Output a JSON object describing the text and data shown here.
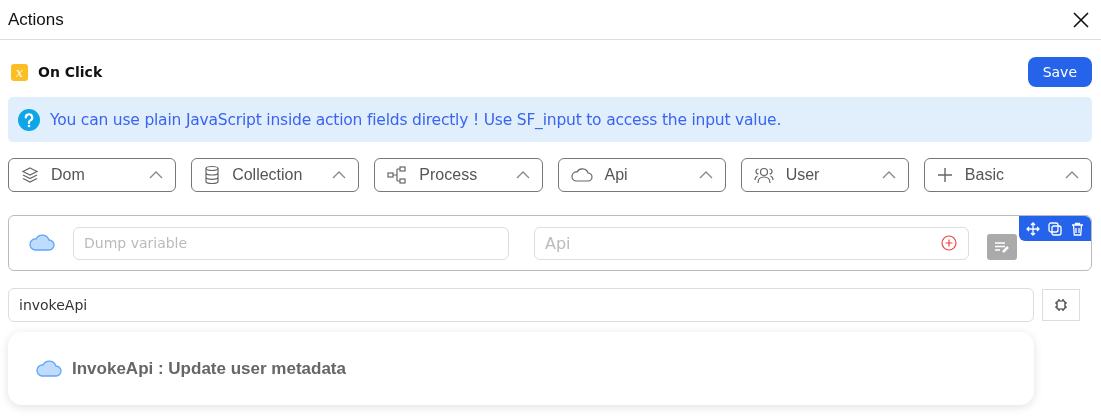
{
  "window": {
    "title": "Actions"
  },
  "event": {
    "label": "On Click",
    "badge": "x"
  },
  "save_button": "Save",
  "info": "You can use plain JavaScript inside action fields directly ! Use SF_input to access the input value.",
  "categories": [
    {
      "label": "Dom"
    },
    {
      "label": "Collection"
    },
    {
      "label": "Process"
    },
    {
      "label": "Api"
    },
    {
      "label": "User"
    },
    {
      "label": "Basic"
    }
  ],
  "action": {
    "variable_placeholder": "Dump variable",
    "api_placeholder": "Api"
  },
  "search": {
    "value": "invokeApi"
  },
  "suggestions": [
    {
      "label": "InvokeApi : Update user metadata"
    }
  ]
}
